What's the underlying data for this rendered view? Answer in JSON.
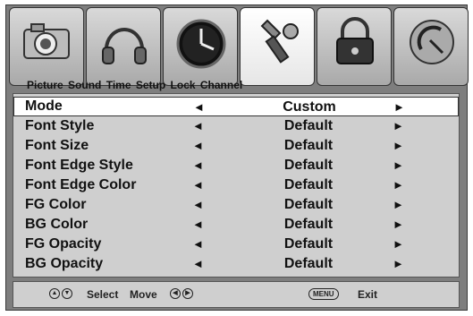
{
  "tabs": [
    {
      "label": "Picture",
      "icon": "camera-icon"
    },
    {
      "label": "Sound",
      "icon": "headphones-icon"
    },
    {
      "label": "Time",
      "icon": "clock-icon"
    },
    {
      "label": "Setup",
      "icon": "tools-icon"
    },
    {
      "label": "Lock",
      "icon": "padlock-icon"
    },
    {
      "label": "Channel",
      "icon": "satellite-dish-icon"
    }
  ],
  "active_tab": "Setup",
  "rows": [
    {
      "label": "Mode",
      "value": "Custom",
      "selected": true
    },
    {
      "label": "Font Style",
      "value": "Default"
    },
    {
      "label": "Font Size",
      "value": "Default"
    },
    {
      "label": "Font Edge Style",
      "value": "Default"
    },
    {
      "label": "Font Edge Color",
      "value": "Default"
    },
    {
      "label": "FG Color",
      "value": "Default"
    },
    {
      "label": "BG Color",
      "value": "Default"
    },
    {
      "label": "FG Opacity",
      "value": "Default"
    },
    {
      "label": "BG Opacity",
      "value": "Default"
    }
  ],
  "arrows": {
    "left": "◄",
    "right": "►"
  },
  "footer": {
    "select_label": "Select",
    "move_label": "Move",
    "menu_key": "MENU",
    "exit_label": "Exit"
  }
}
